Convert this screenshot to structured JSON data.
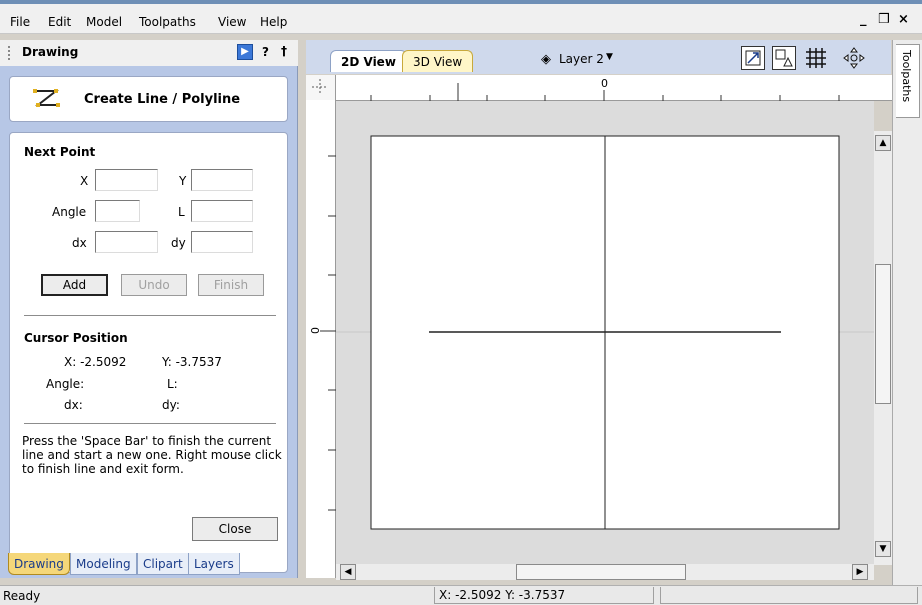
{
  "menu": [
    "File",
    "Edit",
    "Model",
    "Toolpaths",
    "View",
    "Help"
  ],
  "window_controls": {
    "minimize": "_",
    "restore": "̅̅⧉",
    "close": "×"
  },
  "panel": {
    "title": "Drawing",
    "help": "?",
    "pin": "†",
    "form_title": "Create Line / Polyline",
    "next_point": {
      "heading": "Next Point",
      "x_label": "X",
      "y_label": "Y",
      "angle_label": "Angle",
      "l_label": "L",
      "dx_label": "dx",
      "dy_label": "dy",
      "x_value": "",
      "y_value": "",
      "angle_value": "",
      "l_value": "",
      "dx_value": "",
      "dy_value": ""
    },
    "buttons": {
      "add": "Add",
      "undo": "Undo",
      "finish": "Finish",
      "close": "Close"
    },
    "cursor": {
      "heading": "Cursor Position",
      "x_text": "X:  -2.5092",
      "y_text": "Y:  -3.7537",
      "angle_label": "Angle:",
      "l_label": "L:",
      "dx_label": "dx:",
      "dy_label": "dy:"
    },
    "help_text": "Press the 'Space Bar' to finish the current line and start a new one. Right mouse click to finish line and exit form."
  },
  "bottom_tabs": [
    "Drawing",
    "Modeling",
    "Clipart",
    "Layers"
  ],
  "view_tabs": [
    "2D View",
    "3D View"
  ],
  "layer": "Layer 2",
  "right_tab": "Toolpaths",
  "ruler": {
    "top_zero": "0",
    "left_zero": "0"
  },
  "status": {
    "left": "Ready",
    "coords": "X: -2.5092 Y: -3.7537"
  },
  "colors": {
    "panel_bg": "#b7c7e6",
    "accent": "#6e8fb6",
    "tab_2d": "#ffffff",
    "tab_3d": "#fff6c8"
  }
}
